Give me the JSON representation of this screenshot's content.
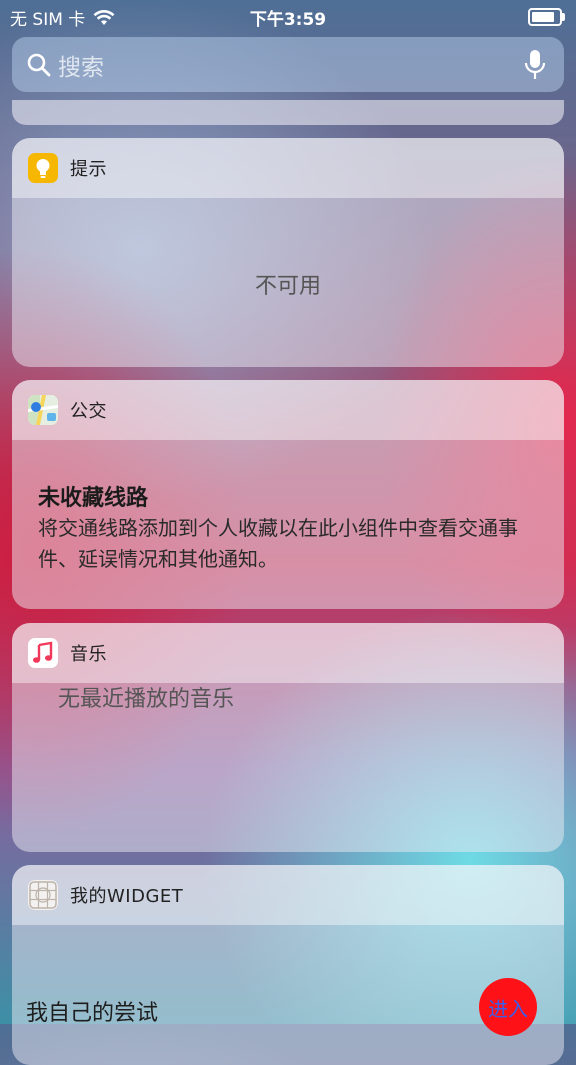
{
  "status": {
    "carrier": "无 SIM 卡",
    "time": "下午3:59",
    "battery_level": 0.9
  },
  "search": {
    "placeholder": "搜索"
  },
  "widgets": {
    "tips": {
      "title": "提示",
      "icon": "lightbulb-icon",
      "message": "不可用"
    },
    "transit": {
      "title": "公交",
      "icon": "maps-icon",
      "heading": "未收藏线路",
      "description": "将交通线路添加到个人收藏以在此小组件中查看交通事件、延误情况和其他通知。"
    },
    "music": {
      "title": "音乐",
      "icon": "music-note-icon",
      "message": "无最近播放的音乐"
    },
    "my_widget": {
      "title": "我的WIDGET",
      "icon": "grid-icon",
      "text": "我自己的尝试",
      "button_label": "进入"
    }
  },
  "colors": {
    "tips_icon": "#f6b700",
    "enter_button": "#ff1118",
    "enter_button_text": "#3c5fe8"
  }
}
